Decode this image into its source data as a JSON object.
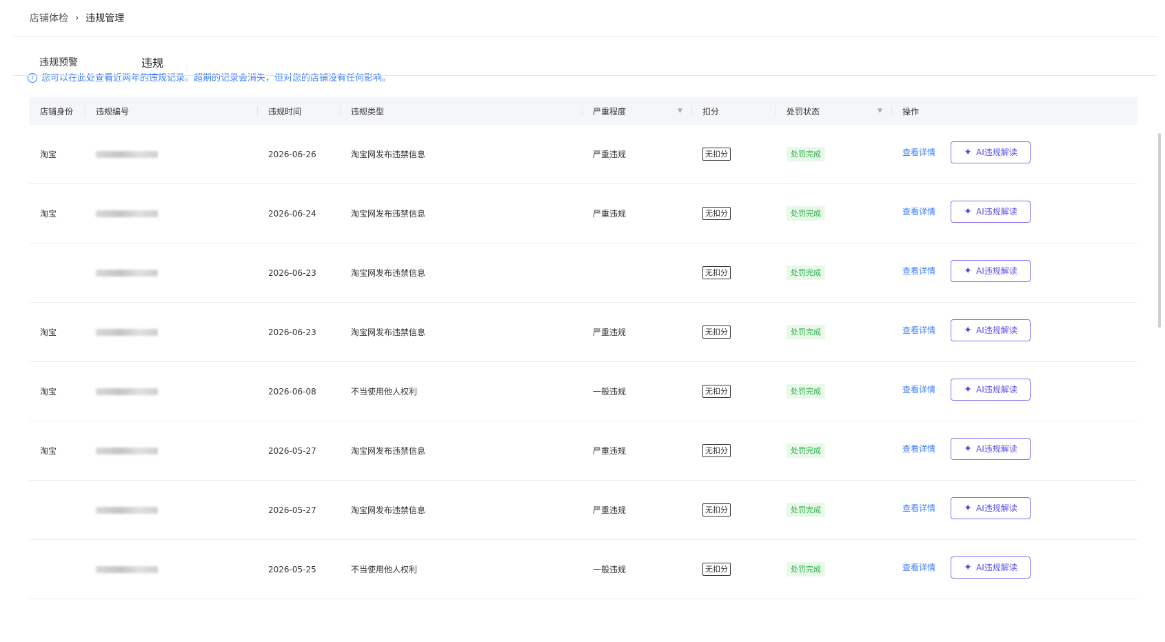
{
  "breadcrumb": {
    "parent": "店铺体检",
    "separator": "›",
    "current": "违规管理"
  },
  "tabs": [
    {
      "label": "违规预警",
      "active": false
    },
    {
      "label": "违规",
      "active": true
    }
  ],
  "notice": {
    "icon": "info-icon",
    "text": "您可以在此处查看近两年的违规记录。超期的记录会消失，但对您的店铺没有任何影响。"
  },
  "table": {
    "headers": [
      "店铺身份",
      "违规编号",
      "违规时间",
      "违规类型",
      "严重程度",
      "扣分",
      "处罚状态",
      "操作"
    ],
    "rows": [
      {
        "shop": "淘宝",
        "date": "2026-06-26",
        "type": "淘宝网发布违禁信息",
        "severity": "严重违规",
        "points": "无扣分",
        "status": "处罚完成",
        "detail": "查看详情",
        "ai": "AI违规解读"
      },
      {
        "shop": "淘宝",
        "date": "2026-06-24",
        "type": "淘宝网发布违禁信息",
        "severity": "严重违规",
        "points": "无扣分",
        "status": "处罚完成",
        "detail": "查看详情",
        "ai": "AI违规解读"
      },
      {
        "shop": "",
        "date": "2026-06-23",
        "type": "淘宝网发布违禁信息",
        "severity": "",
        "points": "无扣分",
        "status": "处罚完成",
        "detail": "查看详情",
        "ai": "AI违规解读"
      },
      {
        "shop": "淘宝",
        "date": "2026-06-23",
        "type": "淘宝网发布违禁信息",
        "severity": "严重违规",
        "points": "无扣分",
        "status": "处罚完成",
        "detail": "查看详情",
        "ai": "AI违规解读"
      },
      {
        "shop": "淘宝",
        "date": "2026-06-08",
        "type": "不当使用他人权利",
        "severity": "一般违规",
        "points": "无扣分",
        "status": "处罚完成",
        "detail": "查看详情",
        "ai": "AI违规解读"
      },
      {
        "shop": "淘宝",
        "date": "2026-05-27",
        "type": "淘宝网发布违禁信息",
        "severity": "严重违规",
        "points": "无扣分",
        "status": "处罚完成",
        "detail": "查看详情",
        "ai": "AI违规解读"
      },
      {
        "shop": "",
        "date": "2026-05-27",
        "type": "淘宝网发布违禁信息",
        "severity": "严重违规",
        "points": "无扣分",
        "status": "处罚完成",
        "detail": "查看详情",
        "ai": "AI违规解读"
      },
      {
        "shop": "",
        "date": "2026-05-25",
        "type": "不当使用他人权利",
        "severity": "一般违规",
        "points": "无扣分",
        "status": "处罚完成",
        "detail": "查看详情",
        "ai": "AI违规解读"
      }
    ]
  },
  "colors": {
    "link": "#3d7ef5",
    "status_bg": "#e9f8e9",
    "status_text": "#27b148",
    "ai_border": "#8a6cf0",
    "tab_underline": "#1d5ce8"
  },
  "icons": {
    "filter": "filter-icon",
    "ai": "sparkle-icon",
    "info": "info-icon"
  }
}
